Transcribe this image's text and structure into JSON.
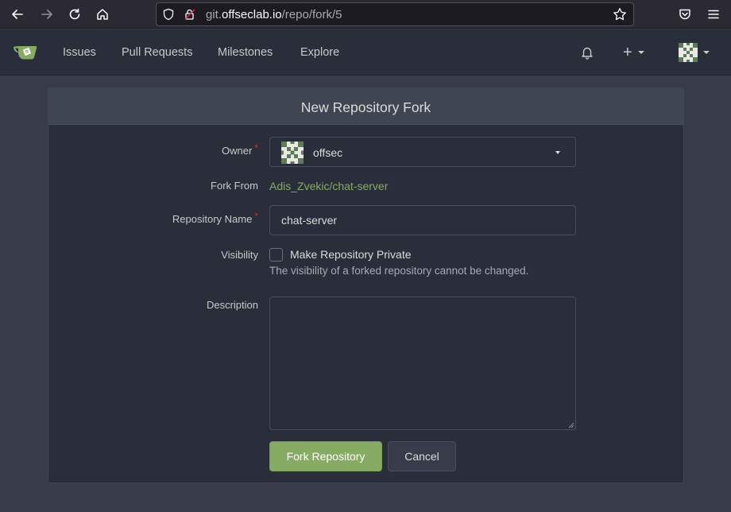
{
  "browser": {
    "url_host_prefix": "git.",
    "url_host": "offseclab.io",
    "url_path": "/repo/fork/5"
  },
  "nav": {
    "items": [
      "Issues",
      "Pull Requests",
      "Milestones",
      "Explore"
    ],
    "add_symbol": "+"
  },
  "page": {
    "title": "New Repository Fork"
  },
  "form": {
    "owner_label": "Owner",
    "owner_value": "offsec",
    "fork_from_label": "Fork From",
    "fork_from_value": "Adis_Zvekic/chat-server",
    "repo_name_label": "Repository Name",
    "repo_name_value": "chat-server",
    "visibility_label": "Visibility",
    "private_checkbox_label": "Make Repository Private",
    "private_checked": false,
    "visibility_help": "The visibility of a forked repository cannot be changed.",
    "description_label": "Description",
    "description_value": "",
    "required_marker": "*",
    "submit_label": "Fork Repository",
    "cancel_label": "Cancel"
  },
  "colors": {
    "accent_green": "#87ab63",
    "required_red": "#db2828",
    "background": "#383c4a",
    "panel": "#2a2e3a"
  },
  "icons": {
    "browser": [
      "back-arrow-icon",
      "forward-arrow-icon",
      "reload-icon",
      "home-icon",
      "shield-icon",
      "lock-icon",
      "star-icon",
      "pocket-icon",
      "hamburger-menu-icon"
    ],
    "app": [
      "gitea-logo-icon",
      "bell-icon",
      "plus-icon",
      "avatar-identicon"
    ]
  }
}
